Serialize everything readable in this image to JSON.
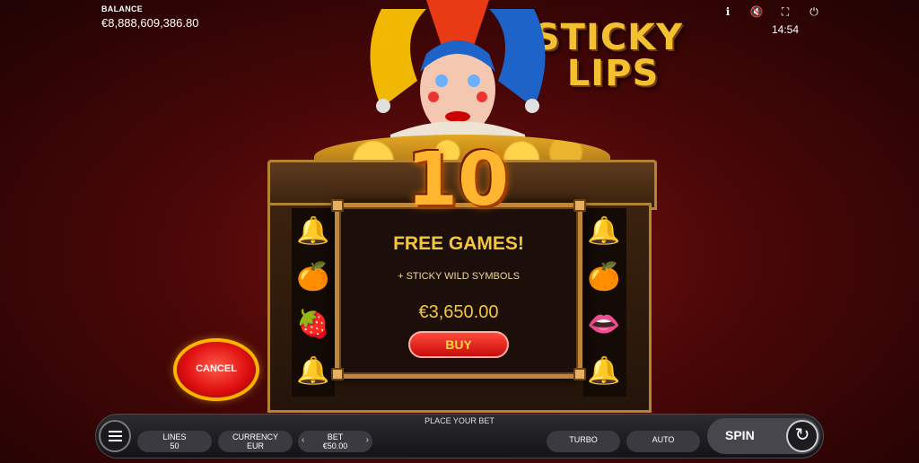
{
  "hud": {
    "balance_label": "BALANCE",
    "balance_value": "€8,888,609,386.80",
    "time": "14:54",
    "icons": [
      "info-icon",
      "mute-icon",
      "fullscreen-icon",
      "power-icon"
    ]
  },
  "logo": {
    "line1": "STICKY",
    "line2": "LIPS"
  },
  "popup": {
    "count": "10",
    "title": "FREE GAMES!",
    "feature": "+ STICKY WILD SYMBOLS",
    "price": "€3,650.00",
    "buy_label": "BUY"
  },
  "cancel_label": "CANCEL",
  "reels": {
    "left": [
      "bell",
      "orange",
      "strawberry",
      "bell"
    ],
    "right": [
      "bell",
      "orange",
      "lips",
      "bell"
    ]
  },
  "bottom_bar": {
    "status": "PLACE YOUR BET",
    "lines_label": "LINES",
    "lines_value": "50",
    "currency_label": "CURRENCY",
    "currency_value": "EUR",
    "bet_label": "BET",
    "bet_value": "€50.00",
    "turbo_label": "TURBO",
    "auto_label": "AUTO",
    "spin_label": "SPIN"
  },
  "colors": {
    "accent_gold": "#f4c640",
    "button_red": "#c80c0c",
    "background": "#4a0707"
  }
}
